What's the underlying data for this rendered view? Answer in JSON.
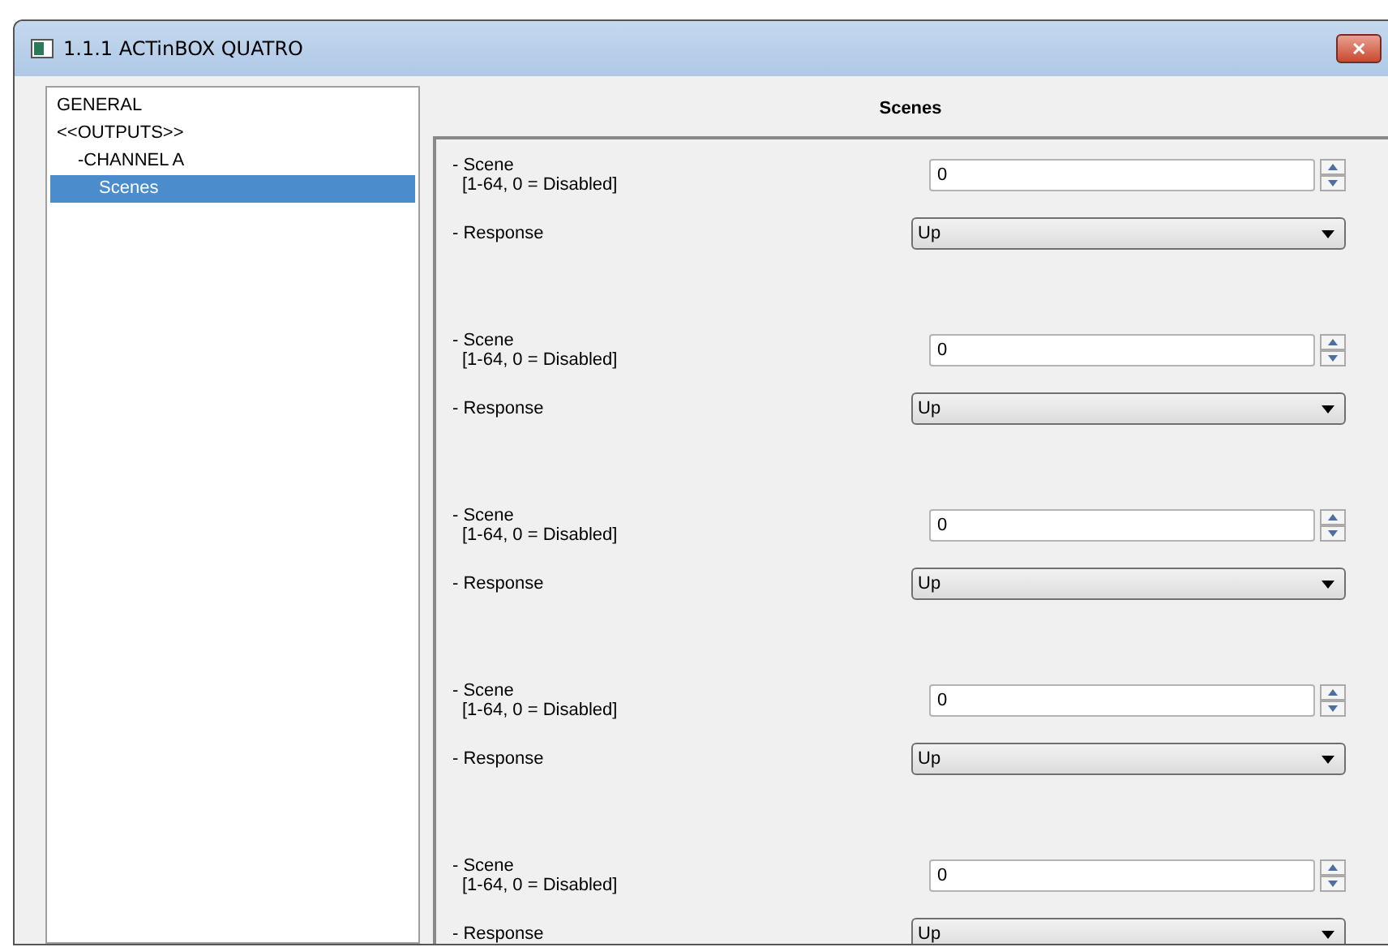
{
  "window": {
    "title": "1.1.1 ACTinBOX QUATRO",
    "close": "✕"
  },
  "tree": [
    {
      "label": "GENERAL",
      "selected": false
    },
    {
      "label": "<<OUTPUTS>>",
      "selected": false,
      "children": [
        {
          "label": "-CHANNEL A",
          "selected": false,
          "children": [
            {
              "label": "Scenes",
              "selected": true
            }
          ]
        }
      ]
    }
  ],
  "panel": {
    "title": "Scenes",
    "groups": [
      {
        "scene_label": "- Scene",
        "range": "[1-64, 0 = Disabled]",
        "scene_value": "0",
        "response_label": "- Response",
        "response_value": "Up"
      },
      {
        "scene_label": "- Scene",
        "range": "[1-64, 0 = Disabled]",
        "scene_value": "0",
        "response_label": "- Response",
        "response_value": "Up"
      },
      {
        "scene_label": "- Scene",
        "range": "[1-64, 0 = Disabled]",
        "scene_value": "0",
        "response_label": "- Response",
        "response_value": "Up"
      },
      {
        "scene_label": "- Scene",
        "range": "[1-64, 0 = Disabled]",
        "scene_value": "0",
        "response_label": "- Response",
        "response_value": "Up"
      },
      {
        "scene_label": "- Scene",
        "range": "[1-64, 0 = Disabled]",
        "scene_value": "0",
        "response_label": "- Response",
        "response_value": "Up"
      }
    ]
  }
}
